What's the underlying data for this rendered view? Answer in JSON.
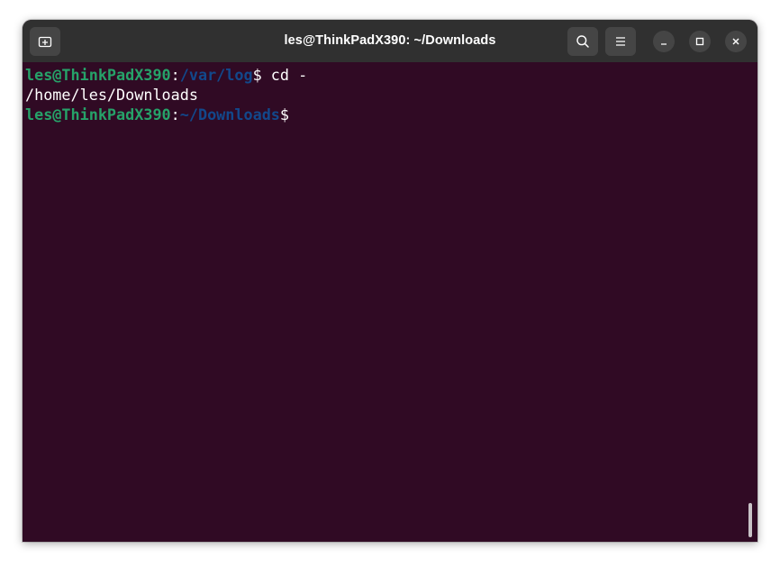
{
  "window": {
    "title": "les@ThinkPadX390: ~/Downloads"
  },
  "titlebar": {
    "new_tab_icon": "new-tab-icon",
    "search_icon": "search-icon",
    "menu_icon": "hamburger-menu-icon",
    "minimize_icon": "minimize-icon",
    "maximize_icon": "maximize-icon",
    "close_icon": "close-icon"
  },
  "terminal": {
    "lines": [
      {
        "user": "les@ThinkPadX390",
        "sep": ":",
        "path": "/var/log",
        "suffix": "$ cd -"
      },
      {
        "output": "/home/les/Downloads"
      },
      {
        "user": "les@ThinkPadX390",
        "sep": ":",
        "path": "~/Downloads",
        "suffix": "$"
      }
    ]
  },
  "colors": {
    "terminal_background": "#300a24",
    "titlebar_background": "#303030",
    "prompt_user": "#26a269",
    "prompt_path": "#12488b",
    "text": "#ffffff"
  }
}
